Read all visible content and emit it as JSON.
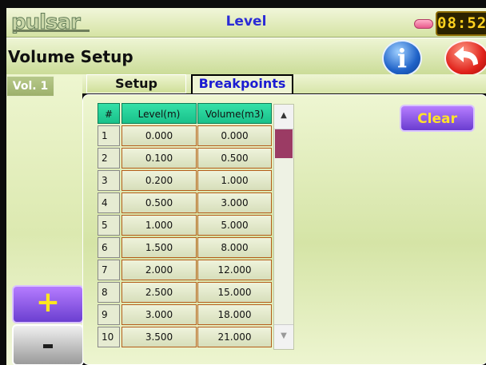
{
  "app": {
    "logo_text": "pulsar",
    "title": "Level",
    "clock": "08:52",
    "colors": {
      "accent_blue": "#2b2bd6",
      "clear_button": "#6a3dd0",
      "table_header": "#19c18a"
    }
  },
  "header": {
    "title": "Volume Setup",
    "info_icon": "info-icon",
    "back_icon": "back-arrow-icon"
  },
  "side": {
    "vol_tab": "Vol. 1",
    "plus_label": "+",
    "minus_label": "-"
  },
  "tabs": [
    {
      "label": "Setup"
    },
    {
      "label": "Breakpoints"
    }
  ],
  "table": {
    "columns": [
      "#",
      "Level(m)",
      "Volume(m3)"
    ],
    "rows": [
      [
        "1",
        "0.000",
        "0.000"
      ],
      [
        "2",
        "0.100",
        "0.500"
      ],
      [
        "3",
        "0.200",
        "1.000"
      ],
      [
        "4",
        "0.500",
        "3.000"
      ],
      [
        "5",
        "1.000",
        "5.000"
      ],
      [
        "6",
        "1.500",
        "8.000"
      ],
      [
        "7",
        "2.000",
        "12.000"
      ],
      [
        "8",
        "2.500",
        "15.000"
      ],
      [
        "9",
        "3.000",
        "18.000"
      ],
      [
        "10",
        "3.500",
        "21.000"
      ]
    ]
  },
  "actions": {
    "clear_label": "Clear"
  }
}
